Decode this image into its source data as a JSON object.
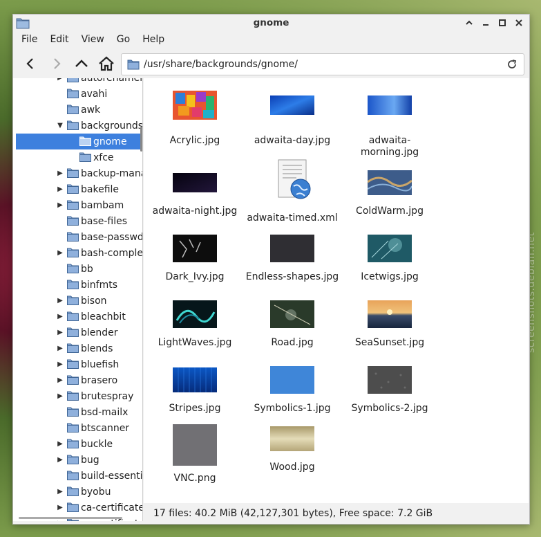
{
  "window": {
    "title": "gnome"
  },
  "menubar": [
    "File",
    "Edit",
    "View",
    "Go",
    "Help"
  ],
  "location": {
    "path": "/usr/share/backgrounds/gnome/"
  },
  "sidebar": {
    "items": [
      {
        "label": "autorenamer",
        "level": 1,
        "expander": "right"
      },
      {
        "label": "avahi",
        "level": 1,
        "expander": ""
      },
      {
        "label": "awk",
        "level": 1,
        "expander": ""
      },
      {
        "label": "backgrounds",
        "level": 1,
        "expander": "down"
      },
      {
        "label": "gnome",
        "level": 2,
        "expander": "",
        "selected": true
      },
      {
        "label": "xfce",
        "level": 2,
        "expander": ""
      },
      {
        "label": "backup-manager",
        "level": 1,
        "expander": "right"
      },
      {
        "label": "bakefile",
        "level": 1,
        "expander": "right"
      },
      {
        "label": "bambam",
        "level": 1,
        "expander": "right"
      },
      {
        "label": "base-files",
        "level": 1,
        "expander": ""
      },
      {
        "label": "base-passwd",
        "level": 1,
        "expander": ""
      },
      {
        "label": "bash-completion",
        "level": 1,
        "expander": "right"
      },
      {
        "label": "bb",
        "level": 1,
        "expander": ""
      },
      {
        "label": "binfmts",
        "level": 1,
        "expander": ""
      },
      {
        "label": "bison",
        "level": 1,
        "expander": "right"
      },
      {
        "label": "bleachbit",
        "level": 1,
        "expander": "right"
      },
      {
        "label": "blender",
        "level": 1,
        "expander": "right"
      },
      {
        "label": "blends",
        "level": 1,
        "expander": "right"
      },
      {
        "label": "bluefish",
        "level": 1,
        "expander": "right"
      },
      {
        "label": "brasero",
        "level": 1,
        "expander": "right"
      },
      {
        "label": "brutespray",
        "level": 1,
        "expander": "right"
      },
      {
        "label": "bsd-mailx",
        "level": 1,
        "expander": ""
      },
      {
        "label": "btscanner",
        "level": 1,
        "expander": ""
      },
      {
        "label": "buckle",
        "level": 1,
        "expander": "right"
      },
      {
        "label": "bug",
        "level": 1,
        "expander": "right"
      },
      {
        "label": "build-essential",
        "level": 1,
        "expander": ""
      },
      {
        "label": "byobu",
        "level": 1,
        "expander": "right"
      },
      {
        "label": "ca-certificates",
        "level": 1,
        "expander": "right"
      },
      {
        "label": "ca-certificates",
        "level": 1,
        "expander": "right"
      }
    ]
  },
  "files": [
    {
      "name": "Acrylic.jpg",
      "thumb": "acrylic"
    },
    {
      "name": "adwaita-day.jpg",
      "thumb": "day"
    },
    {
      "name": "adwaita-morning.jpg",
      "name_line1": "adwaita-",
      "name_line2": "morning.jpg",
      "thumb": "morning"
    },
    {
      "name": "adwaita-night.jpg",
      "thumb": "night"
    },
    {
      "name": "adwaita-timed.xml",
      "thumb": "xml-icon"
    },
    {
      "name": "ColdWarm.jpg",
      "thumb": "coldwarm"
    },
    {
      "name": "Dark_Ivy.jpg",
      "thumb": "darkivy"
    },
    {
      "name": "Endless-shapes.jpg",
      "thumb": "endless"
    },
    {
      "name": "Icetwigs.jpg",
      "thumb": "icetwigs"
    },
    {
      "name": "LightWaves.jpg",
      "thumb": "lightwaves"
    },
    {
      "name": "Road.jpg",
      "thumb": "road"
    },
    {
      "name": "SeaSunset.jpg",
      "thumb": "seasunset"
    },
    {
      "name": "Stripes.jpg",
      "thumb": "stripes"
    },
    {
      "name": "Symbolics-1.jpg",
      "thumb": "symbolics1"
    },
    {
      "name": "Symbolics-2.jpg",
      "thumb": "symbolics2"
    },
    {
      "name": "VNC.png",
      "thumb": "vnc"
    },
    {
      "name": "Wood.jpg",
      "thumb": "wood"
    }
  ],
  "statusbar": {
    "text": "17 files: 40.2  MiB (42,127,301 bytes), Free space: 7.2  GiB"
  },
  "watermark": "screenshots.debian.net",
  "colors": {
    "selection": "#3d80de",
    "folder": "#6b93c4"
  }
}
